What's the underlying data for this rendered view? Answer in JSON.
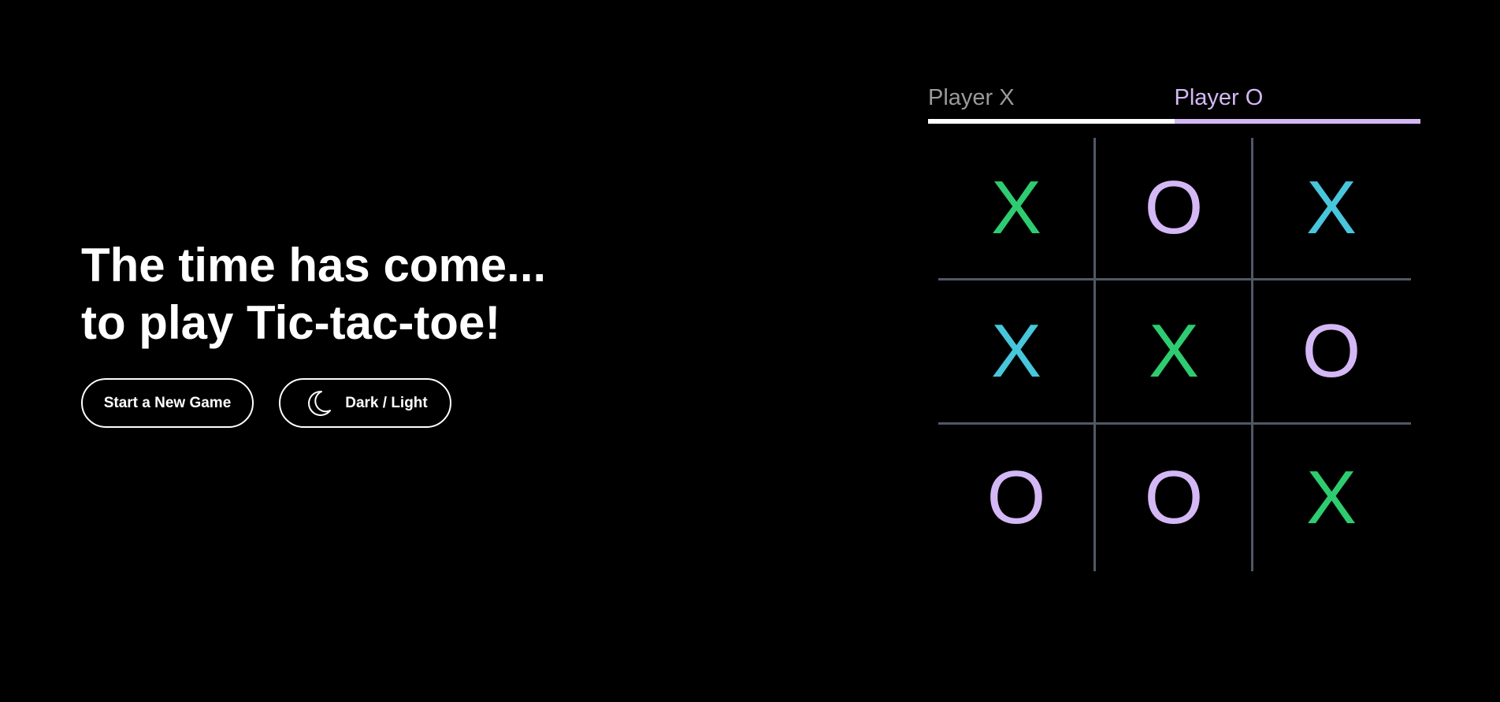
{
  "hero": {
    "line1": "The time has come...",
    "line2": "to play Tic-tac-toe!"
  },
  "buttons": {
    "new_game_label": "Start a New Game",
    "theme_label": "Dark / Light",
    "theme_icon": "moon-icon"
  },
  "players": {
    "x_label": "Player X",
    "o_label": "Player O",
    "current_turn": "O"
  },
  "board": {
    "cells": [
      "X",
      "O",
      "X",
      "X",
      "X",
      "O",
      "O",
      "O",
      "X"
    ],
    "colors": [
      "#2ecc71",
      "#d4b8f5",
      "#48c6db",
      "#48c6db",
      "#2ecc71",
      "#d4b8f5",
      "#d4b8f5",
      "#d4b8f5",
      "#2ecc71"
    ]
  },
  "theme": {
    "background": "#000000",
    "foreground": "#ffffff",
    "grid_color": "#4f5866",
    "accent_o": "#d4b8f5",
    "accent_x_green": "#2ecc71",
    "accent_x_cyan": "#48c6db"
  }
}
